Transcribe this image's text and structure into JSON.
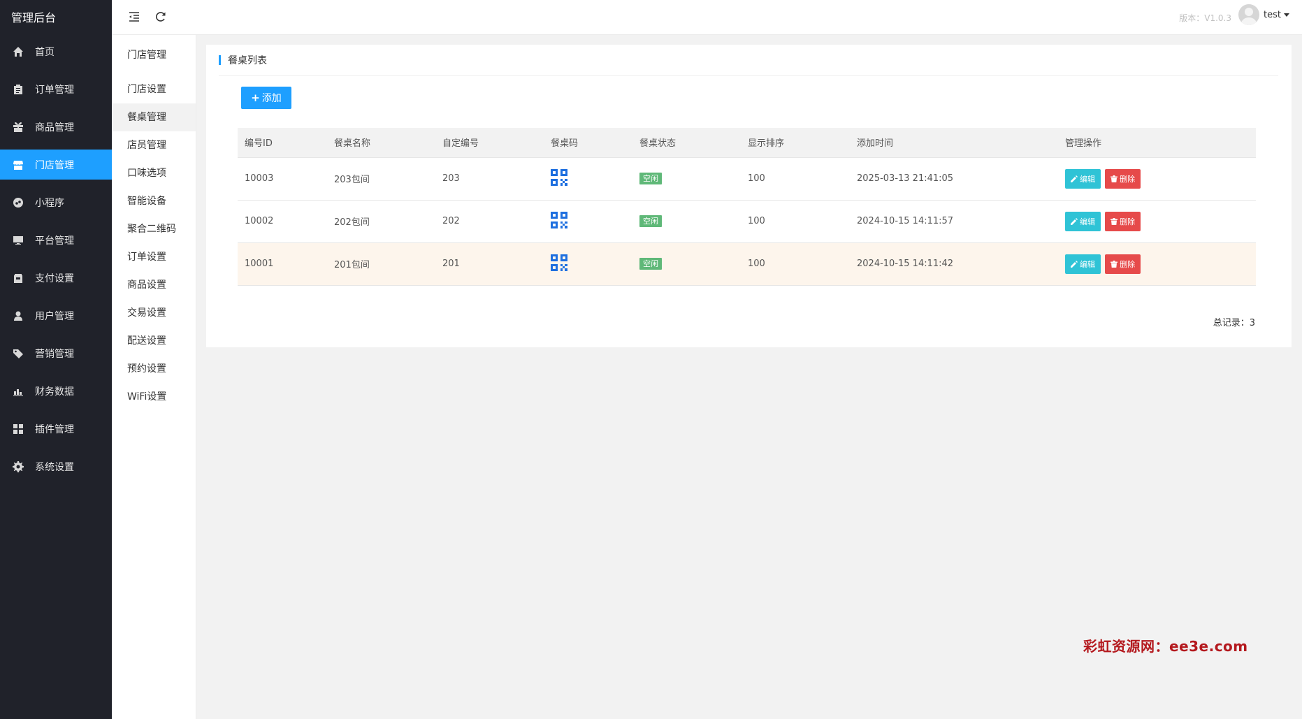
{
  "brand": "管理后台",
  "sidebar": {
    "items": [
      {
        "label": "首页",
        "icon": "home-icon"
      },
      {
        "label": "订单管理",
        "icon": "clipboard-icon"
      },
      {
        "label": "商品管理",
        "icon": "gift-icon"
      },
      {
        "label": "门店管理",
        "icon": "store-icon",
        "active": true
      },
      {
        "label": "小程序",
        "icon": "miniprogram-icon"
      },
      {
        "label": "平台管理",
        "icon": "monitor-icon"
      },
      {
        "label": "支付设置",
        "icon": "wallet-icon"
      },
      {
        "label": "用户管理",
        "icon": "user-icon"
      },
      {
        "label": "营销管理",
        "icon": "tag-icon"
      },
      {
        "label": "财务数据",
        "icon": "chart-icon"
      },
      {
        "label": "插件管理",
        "icon": "puzzle-icon"
      },
      {
        "label": "系统设置",
        "icon": "gear-icon"
      }
    ]
  },
  "subnav": {
    "title": "门店管理",
    "items": [
      "门店设置",
      "餐桌管理",
      "店员管理",
      "口味选项",
      "智能设备",
      "聚合二维码",
      "订单设置",
      "商品设置",
      "交易设置",
      "配送设置",
      "预约设置",
      "WiFi设置"
    ],
    "active": "餐桌管理"
  },
  "header": {
    "version": "版本：V1.0.3",
    "username": "test"
  },
  "card": {
    "title": "餐桌列表",
    "add_label": "添加",
    "columns": [
      "编号ID",
      "餐桌名称",
      "自定编号",
      "餐桌码",
      "餐桌状态",
      "显示排序",
      "添加时间",
      "管理操作"
    ],
    "rows": [
      {
        "id": "10003",
        "name": "203包间",
        "code": "203",
        "status": "空闲",
        "sort": "100",
        "time": "2025-03-13 21:41:05"
      },
      {
        "id": "10002",
        "name": "202包间",
        "code": "202",
        "status": "空闲",
        "sort": "100",
        "time": "2024-10-15 14:11:57"
      },
      {
        "id": "10001",
        "name": "201包间",
        "code": "201",
        "status": "空闲",
        "sort": "100",
        "time": "2024-10-15 14:11:42"
      }
    ],
    "edit_label": "编辑",
    "delete_label": "删除",
    "total": "总记录：3"
  },
  "watermark": "彩虹资源网：ee3e.com",
  "colors": {
    "sidebar_bg": "#20222a",
    "accent": "#1e9fff",
    "status_green": "#5fb878",
    "edit": "#2fc3d6",
    "delete": "#e64a4a"
  }
}
